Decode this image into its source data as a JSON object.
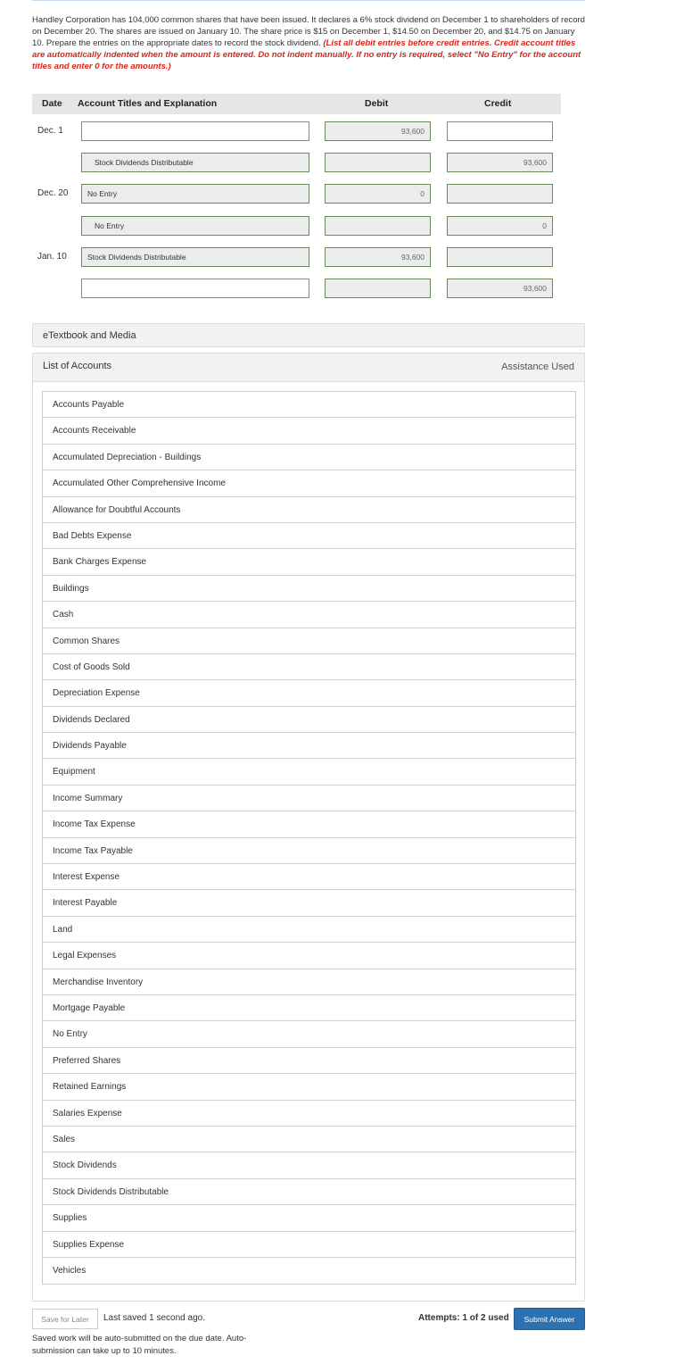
{
  "question": {
    "text": "Handley Corporation has 104,000 common shares that have been issued. It declares a 6% stock dividend on December 1 to shareholders of record on December 20. The shares are issued on January 10. The share price is $15 on December 1, $14.50 on December 20, and $14.75 on January 10. Prepare the entries on the appropriate dates to record the stock dividend. ",
    "instructions": "(List all debit entries before credit entries. Credit account titles are automatically indented when the amount is entered. Do not indent manually. If no entry is required, select \"No Entry\" for the account titles and enter 0 for the amounts.)"
  },
  "journal": {
    "headers": {
      "date": "Date",
      "account": "Account Titles and Explanation",
      "debit": "Debit",
      "credit": "Credit"
    },
    "rows": [
      {
        "date": "Dec. 1",
        "account": "",
        "debit": "93,600",
        "credit": ""
      },
      {
        "date": "",
        "account": "Stock Dividends Distributable",
        "debit": "",
        "credit": "93,600"
      },
      {
        "date": "Dec. 20",
        "account": "No Entry",
        "debit": "0",
        "credit": ""
      },
      {
        "date": "",
        "account": "No Entry",
        "debit": "",
        "credit": "0"
      },
      {
        "date": "Jan. 10",
        "account": "Stock Dividends Distributable",
        "debit": "93,600",
        "credit": ""
      },
      {
        "date": "",
        "account": "",
        "debit": "",
        "credit": "93,600"
      }
    ]
  },
  "etextbook": {
    "label": "eTextbook and Media"
  },
  "accounts_panel": {
    "title": "List of Accounts",
    "assistance": "Assistance Used",
    "items": [
      "Accounts Payable",
      "Accounts Receivable",
      "Accumulated Depreciation - Buildings",
      "Accumulated Other Comprehensive Income",
      "Allowance for Doubtful Accounts",
      "Bad Debts Expense",
      "Bank Charges Expense",
      "Buildings",
      "Cash",
      "Common Shares",
      "Cost of Goods Sold",
      "Depreciation Expense",
      "Dividends Declared",
      "Dividends Payable",
      "Equipment",
      "Income Summary",
      "Income Tax Expense",
      "Income Tax Payable",
      "Interest Expense",
      "Interest Payable",
      "Land",
      "Legal Expenses",
      "Merchandise Inventory",
      "Mortgage Payable",
      "No Entry",
      "Preferred Shares",
      "Retained Earnings",
      "Salaries Expense",
      "Sales",
      "Stock Dividends",
      "Stock Dividends Distributable",
      "Supplies",
      "Supplies Expense",
      "Vehicles"
    ]
  },
  "footer": {
    "save_label": "Save for Later",
    "saved_status": "Last saved 1 second ago.",
    "auto_submit_note": "Saved work will be auto-submitted on the due date. Auto-submission can take up to 10 minutes.",
    "attempts": "Attempts: 1 of 2 used",
    "submit_label": "Submit Answer"
  }
}
